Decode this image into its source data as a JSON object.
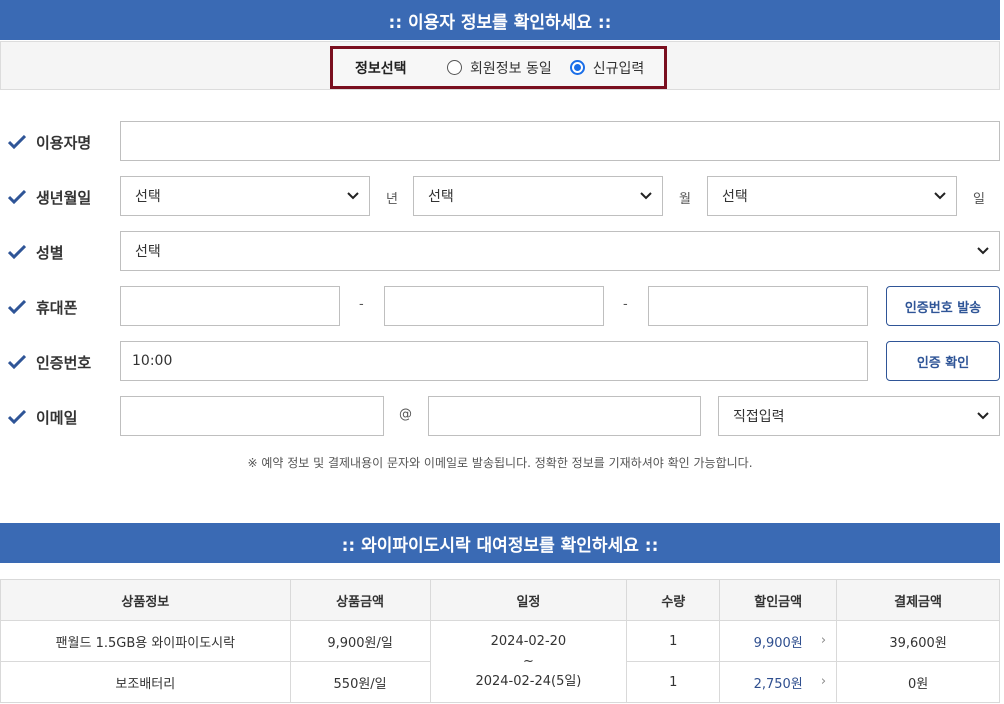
{
  "section1": {
    "title": ":: 이용자 정보를 확인하세요 ::"
  },
  "info_select": {
    "label": "정보선택",
    "options": [
      {
        "label": "회원정보 동일",
        "checked": false
      },
      {
        "label": "신규입력",
        "checked": true
      }
    ]
  },
  "form": {
    "name": {
      "label": "이용자명",
      "value": ""
    },
    "birth": {
      "label": "생년월일",
      "year": {
        "value": "선택",
        "unit": "년"
      },
      "month": {
        "value": "선택",
        "unit": "월"
      },
      "day": {
        "value": "선택",
        "unit": "일"
      }
    },
    "gender": {
      "label": "성별",
      "value": "선택"
    },
    "phone": {
      "label": "휴대폰",
      "separator": "-",
      "part1": "",
      "part2": "",
      "part3": "",
      "send_button": "인증번호 발송"
    },
    "verify": {
      "label": "인증번호",
      "timer": "10:00",
      "confirm_button": "인증 확인"
    },
    "email": {
      "label": "이메일",
      "local": "",
      "at": "@",
      "domain": "",
      "domain_select": "직접입력"
    },
    "notice": "※ 예약 정보 및 결제내용이 문자와 이메일로 발송됩니다. 정확한 정보를 기재하셔야 확인 가능합니다."
  },
  "section2": {
    "title": ":: 와이파이도시락 대여정보를 확인하세요 ::"
  },
  "rental_table": {
    "headers": [
      "상품정보",
      "상품금액",
      "일정",
      "수량",
      "할인금액",
      "결제금액"
    ],
    "rows": [
      {
        "product": "팬월드 1.5GB용 와이파이도시락",
        "price": "9,900원/일",
        "qty": "1",
        "discount": "9,900원",
        "total": "39,600원"
      },
      {
        "product": "보조배터리",
        "price": "550원/일",
        "qty": "1",
        "discount": "2,750원",
        "total": "0원"
      }
    ],
    "schedule": {
      "start": "2024-02-20",
      "tilde": "~",
      "end": "2024-02-24(5일)"
    }
  },
  "colors": {
    "header_bar": "#3a6ab4",
    "highlight_border": "#7a0f1f",
    "radio_checked": "#1a6ee8",
    "button_text": "#2f5597"
  }
}
